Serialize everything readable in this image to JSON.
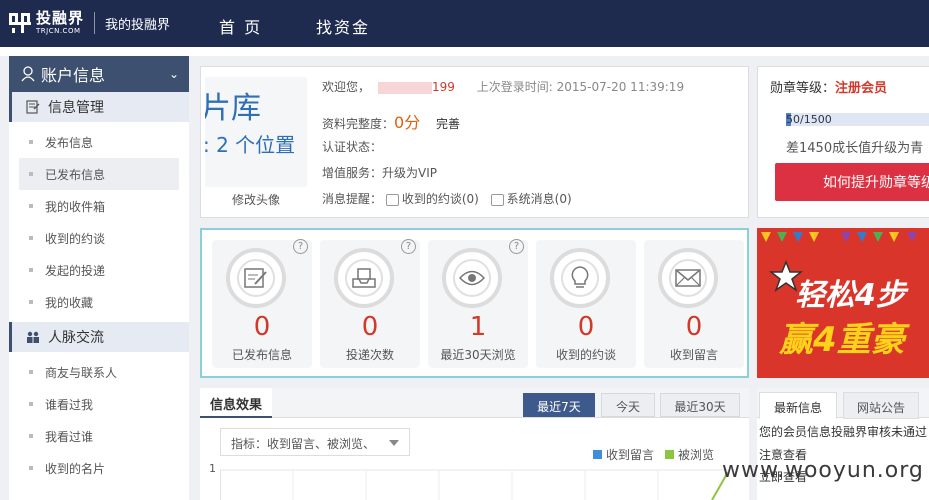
{
  "header": {
    "logo_cn": "投融界",
    "logo_en": "TRJCN.COM",
    "logo_sub": "我的投融界",
    "nav": [
      "首 页",
      "找资金"
    ]
  },
  "sidebar": {
    "title": "账户信息",
    "sections": [
      {
        "label": "信息管理",
        "icon": "doc-icon",
        "items": [
          "发布信息",
          "已发布信息",
          "我的收件箱",
          "收到的约谈",
          "发起的投递",
          "我的收藏"
        ]
      },
      {
        "label": "人脉交流",
        "icon": "people-icon",
        "items": [
          "商友与联系人",
          "谁看过我",
          "我看过谁",
          "收到的名片"
        ]
      }
    ],
    "active_item": "已发布信息"
  },
  "profile": {
    "avatar_line1": "片库",
    "avatar_line2": ": 2 个位置",
    "avatar_link": "修改头像",
    "welcome": "欢迎您，",
    "username_suffix": "199",
    "last_login_label": "上次登录时间:",
    "last_login_time": "2015-07-20 11:39:19",
    "completeness_label": "资料完整度：",
    "completeness_value": "0分",
    "complete_link": "完善",
    "auth_label": "认证状态：",
    "vip_label": "增值服务：",
    "vip_link": "升级为VIP",
    "msg_label": "消息提醒：",
    "msg_interview": "收到的约谈(0)",
    "msg_system": "系统消息(0)"
  },
  "badge": {
    "level_label": "勋章等级：",
    "level_value": "注册会员",
    "progress_text": "50/1500",
    "progress_fraction": 0.0333,
    "upgrade_text": "差1450成长值升级为青",
    "button": "如何提升勋章等级"
  },
  "stats": [
    {
      "value": "0",
      "label": "已发布信息",
      "icon": "edit-doc-icon",
      "help": "?"
    },
    {
      "value": "0",
      "label": "投递次数",
      "icon": "tray-icon",
      "help": "?"
    },
    {
      "value": "1",
      "label": "最近30天浏览",
      "icon": "eye-icon",
      "help": "?"
    },
    {
      "value": "0",
      "label": "收到的约谈",
      "icon": "bulb-icon",
      "help": ""
    },
    {
      "value": "0",
      "label": "收到留言",
      "icon": "envelope-icon",
      "help": ""
    }
  ],
  "promo": {
    "line1": "轻松4步",
    "line2": "赢4重豪",
    "bg_color": "#d9352b"
  },
  "effect": {
    "title": "信息效果",
    "tabs": [
      "最近7天",
      "今天",
      "最近30天"
    ],
    "active_tab": "最近7天",
    "select_value": "指标：收到留言、被浏览、",
    "legend": [
      {
        "name": "收到留言",
        "color": "#3d8fd8"
      },
      {
        "name": "被浏览",
        "color": "#8cc63f"
      }
    ],
    "y_tick": "1"
  },
  "news": {
    "tabs": [
      "最新信息",
      "网站公告"
    ],
    "active_tab": "最新信息",
    "lines": [
      "您的会员信息投融界审核未通过",
      "注意查看",
      "立即查看"
    ]
  },
  "watermark": "www.wooyun.org"
}
